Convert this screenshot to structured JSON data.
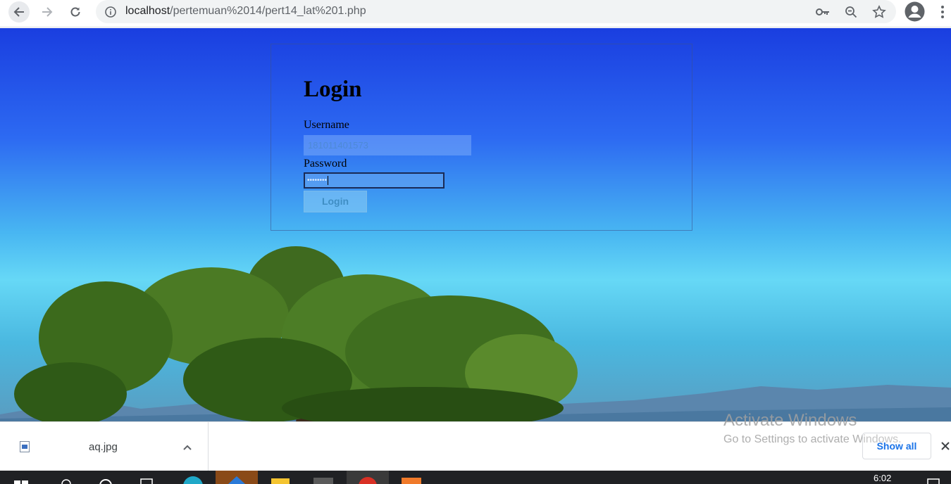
{
  "browser": {
    "url_host": "localhost",
    "url_path": "/pertemuan%2014/pert14_lat%201.php",
    "icons": [
      "back-arrow-icon",
      "forward-arrow-icon",
      "reload-icon",
      "info-icon",
      "key-icon",
      "zoom-icon",
      "star-icon",
      "profile-icon",
      "menu-icon"
    ]
  },
  "login": {
    "title": "Login",
    "username_label": "Username",
    "username_value": "181011401573",
    "password_label": "Password",
    "password_value": "••••••••",
    "button_label": "Login"
  },
  "download_shelf": {
    "file_name": "aq.jpg",
    "show_all_label": "Show all",
    "watermark_title": "Activate Windows",
    "watermark_subtitle": "Go to Settings to activate Windows."
  },
  "taskbar": {
    "time": "6:02"
  },
  "colors": {
    "sky_top": "#1a3ee0",
    "sky_mid": "#66d8f6",
    "accent": "#1a73e8"
  }
}
